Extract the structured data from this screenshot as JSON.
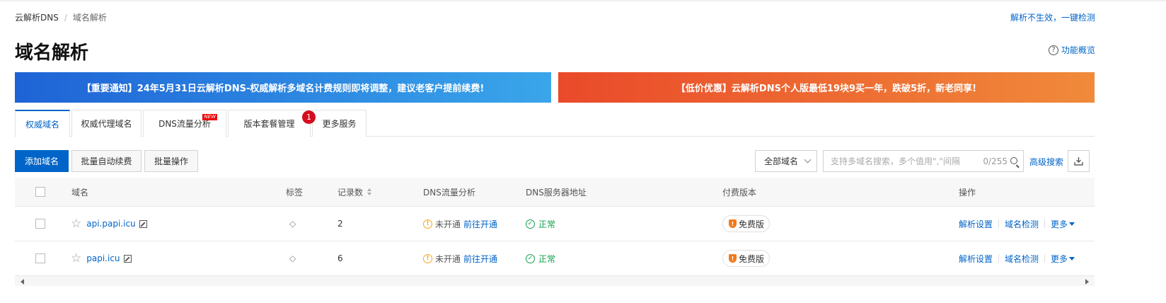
{
  "breadcrumb": {
    "root": "云解析DNS",
    "separator": "/",
    "current": "域名解析"
  },
  "header": {
    "quick_check": "解析不生效，一键检测",
    "title": "域名解析",
    "overview_link": "功能概览",
    "overview_icon": "question-circle-icon"
  },
  "banners": [
    {
      "text": "【重要通知】24年5月31日云解析DNS-权威解析多域名计费规则即将调整，建议老客户提前续费!",
      "color_from": "#1e63d6",
      "color_to": "#3aa6ea"
    },
    {
      "text": "【低价优惠】云解析DNS个人版最低19块9买一年，跌破5折，新老同享!",
      "color_from": "#ea4a2a",
      "color_to": "#f08a3a"
    }
  ],
  "tabs": [
    {
      "label": "权威域名",
      "active": true
    },
    {
      "label": "权威代理域名",
      "active": false
    },
    {
      "label": "DNS流量分析",
      "active": false,
      "badge": "NEW"
    },
    {
      "label": "版本套餐管理",
      "active": false,
      "count": "1"
    },
    {
      "label": "更多服务",
      "active": false
    }
  ],
  "toolbar": {
    "add_domain": "添加域名",
    "batch_renew": "批量自动续费",
    "batch_ops": "批量操作",
    "filter_value": "全部域名",
    "search_placeholder": "支持多域名搜索，多个值用\",\"间隔",
    "search_count": "0/255",
    "advanced_search": "高级搜索"
  },
  "table": {
    "headers": [
      "域名",
      "标签",
      "记录数",
      "DNS流量分析",
      "DNS服务器地址",
      "付费版本",
      "操作"
    ],
    "rows": [
      {
        "domain": "api.papi.icu",
        "records": "2",
        "traffic_status": "未开通",
        "traffic_action": "前往开通",
        "dns_status": "正常",
        "version": "免费版",
        "op1": "解析设置",
        "op2": "域名检测",
        "op3": "更多"
      },
      {
        "domain": "papi.icu",
        "records": "6",
        "traffic_status": "未开通",
        "traffic_action": "前往开通",
        "dns_status": "正常",
        "version": "免费版",
        "op1": "解析设置",
        "op2": "域名检测",
        "op3": "更多"
      }
    ]
  },
  "colors": {
    "accent": "#0064c8",
    "success": "#12a14b",
    "warning": "#f5a623",
    "badge_red": "#d50d1f"
  }
}
